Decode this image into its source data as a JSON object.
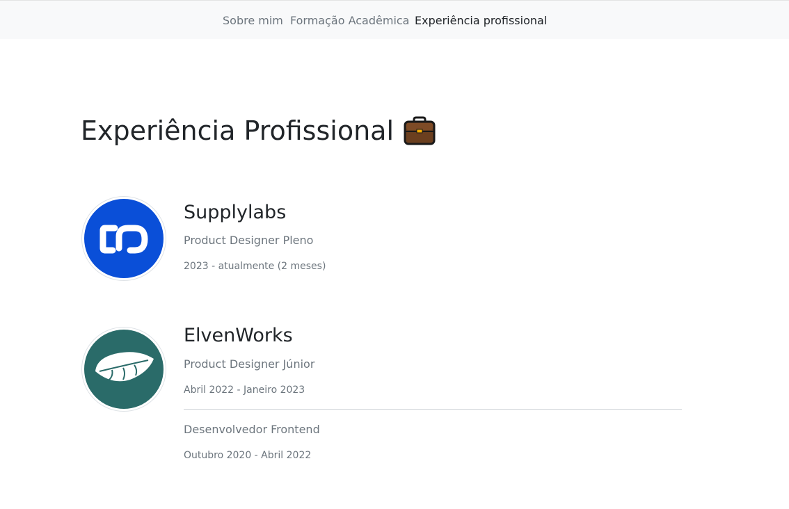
{
  "nav": {
    "items": [
      {
        "label": "Sobre mim",
        "active": false
      },
      {
        "label": "Formação Acadêmica",
        "active": false
      },
      {
        "label": "Experiência profissional",
        "active": true
      }
    ]
  },
  "page": {
    "title": "Experiência Profissional",
    "title_icon": "briefcase-icon"
  },
  "experiences": [
    {
      "company": "Supplylabs",
      "logo_icon": "supplylabs-logo",
      "logo_color": "#0a4fd8",
      "roles": [
        {
          "title": "Product Designer Pleno",
          "period": "2023 - atualmente (2 meses)"
        }
      ]
    },
    {
      "company": "ElvenWorks",
      "logo_icon": "elvenworks-leaf-logo",
      "logo_color": "#2a6b69",
      "roles": [
        {
          "title": "Product Designer Júnior",
          "period": "Abril 2022 - Janeiro 2023"
        },
        {
          "title": "Desenvolvedor Frontend",
          "period": "Outubro 2020 - Abril 2022"
        }
      ]
    }
  ]
}
